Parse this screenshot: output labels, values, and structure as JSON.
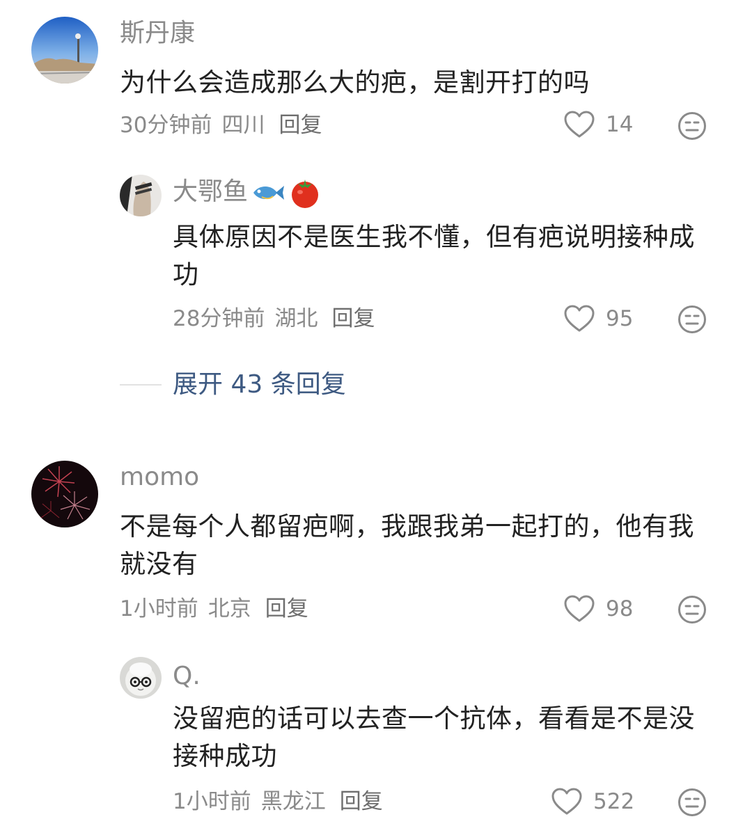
{
  "comments": [
    {
      "username": "斯丹康",
      "text": "为什么会造成那么大的疤，是割开打的吗",
      "time": "30分钟前",
      "location": "四川",
      "reply_label": "回复",
      "likes": "14",
      "replies": [
        {
          "username": "大鄂鱼",
          "text": "具体原因不是医生我不懂，但有疤说明接种成功",
          "time": "28分钟前",
          "location": "湖北",
          "reply_label": "回复",
          "likes": "95"
        }
      ],
      "expand_label": "展开 43 条回复"
    },
    {
      "username": "momo",
      "text": "不是每个人都留疤啊，我跟我弟一起打的，他有我就没有",
      "time": "1小时前",
      "location": "北京",
      "reply_label": "回复",
      "likes": "98",
      "replies": [
        {
          "username": "Q.",
          "text": "没留疤的话可以去查一个抗体，看看是不是没接种成功",
          "time": "1小时前",
          "location": "黑龙江",
          "reply_label": "回复",
          "likes": "522"
        }
      ]
    }
  ],
  "icons": {
    "like": "heart-outline-icon",
    "dislike": "neutral-face-icon",
    "username_emojis": [
      "fish-icon",
      "tomato-icon"
    ]
  },
  "colors": {
    "link": "#3e5a82",
    "meta": "#8a8a8a",
    "text": "#222222"
  }
}
